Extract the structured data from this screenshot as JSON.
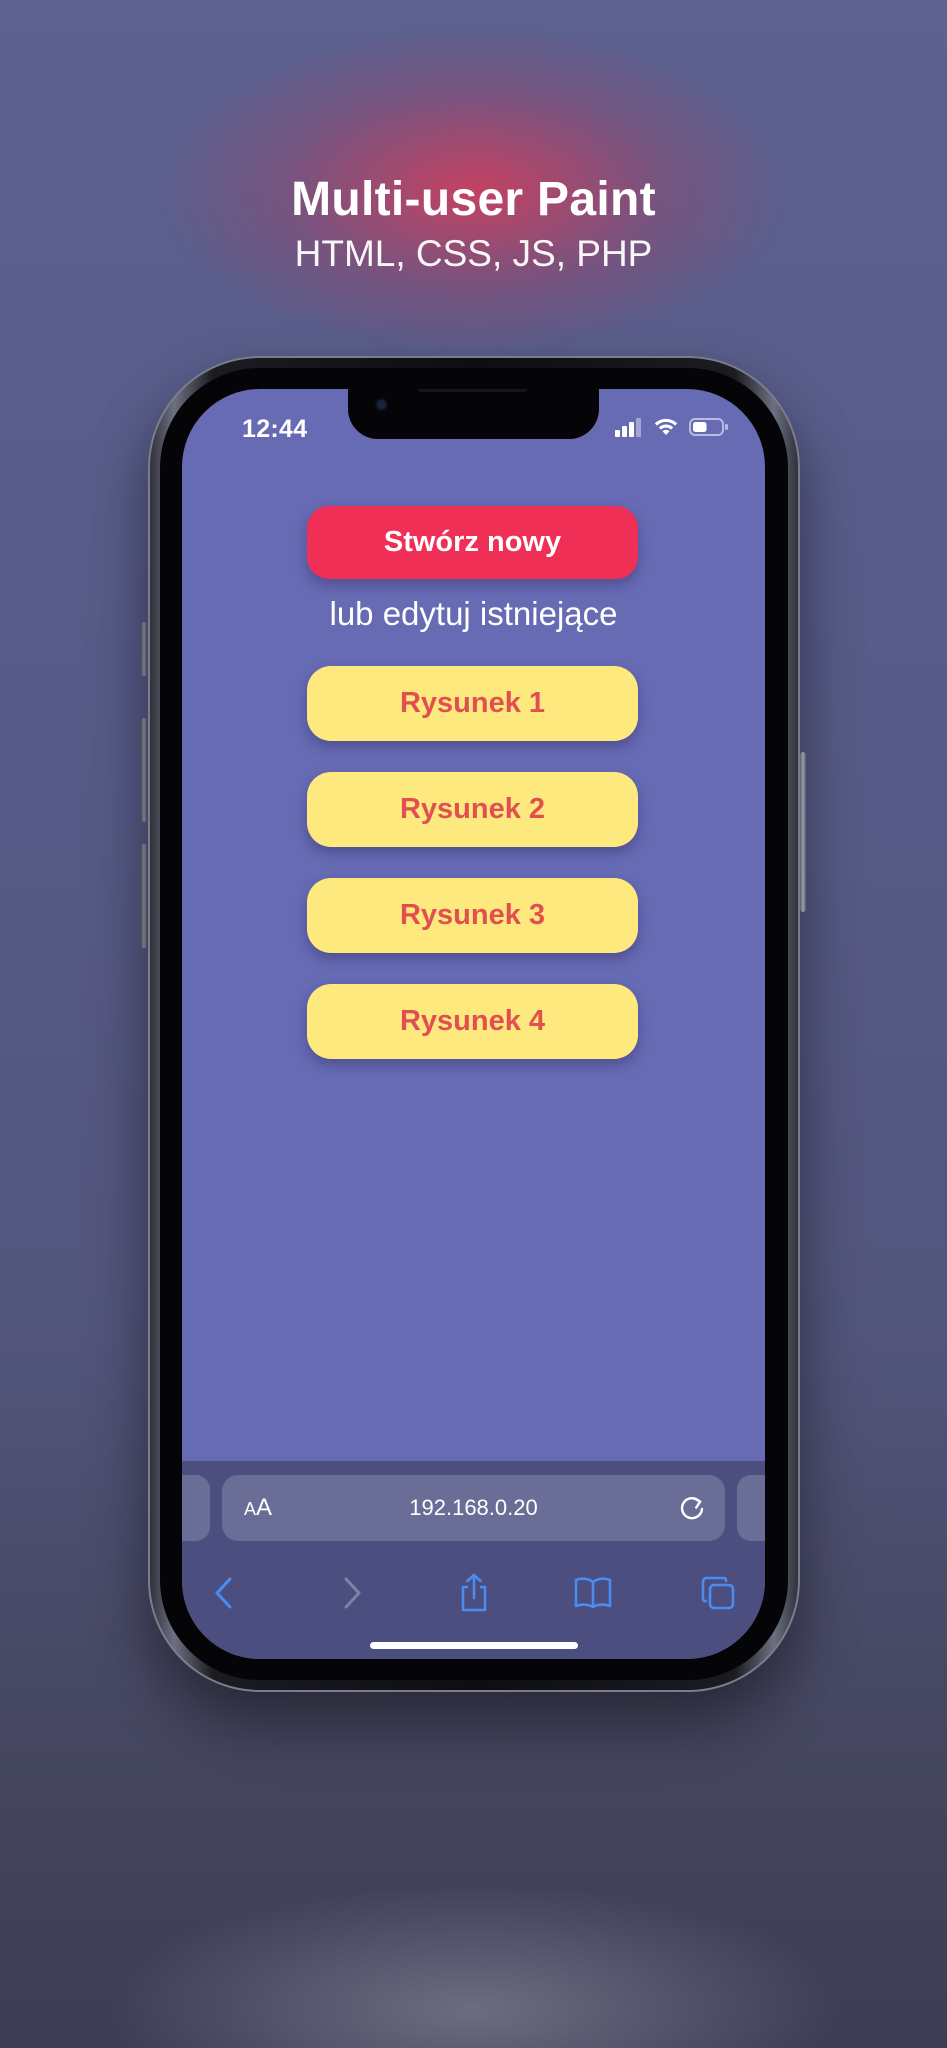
{
  "promo": {
    "title": "Multi-user Paint",
    "subtitle": "HTML, CSS, JS, PHP"
  },
  "status_bar": {
    "time": "12:44",
    "signal_icon": "cellular-signal-icon",
    "wifi_icon": "wifi-icon",
    "battery_icon": "battery-icon",
    "battery_level": 0.5
  },
  "page": {
    "create_button_label": "Stwórz nowy",
    "or_edit_text": "lub edytuj istniejące",
    "drawings": [
      "Rysunek 1",
      "Rysunek 2",
      "Rysunek 3",
      "Rysunek 4"
    ]
  },
  "browser": {
    "text_size_label_small": "A",
    "text_size_label_large": "A",
    "url": "192.168.0.20",
    "reload_icon": "reload-icon",
    "toolbar": [
      "back-icon",
      "forward-icon",
      "share-icon",
      "bookmarks-icon",
      "tabs-icon"
    ]
  },
  "colors": {
    "page_background": "#666bb4",
    "create_button": "#ef2f56",
    "drawing_button": "#fde97d",
    "drawing_button_text": "#e24f52",
    "toolbar_icons": "#4a8df2"
  }
}
